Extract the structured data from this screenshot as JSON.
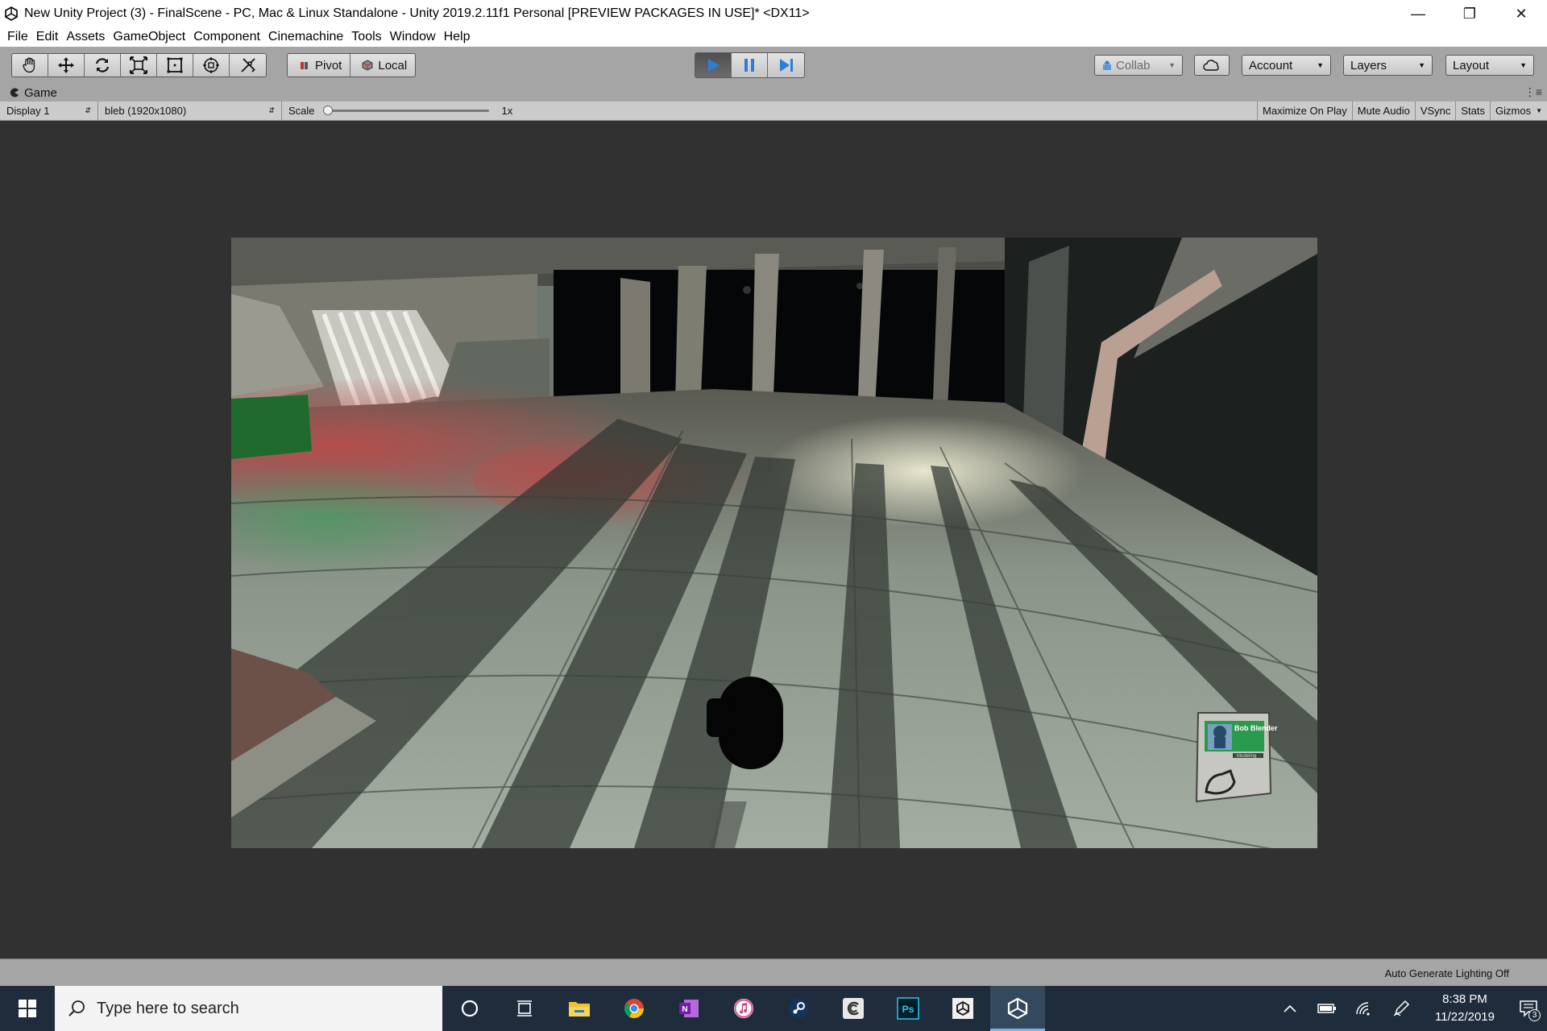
{
  "window": {
    "title": "New Unity Project (3) - FinalScene - PC, Mac & Linux Standalone - Unity 2019.2.11f1 Personal [PREVIEW PACKAGES IN USE]* <DX11>"
  },
  "menu": {
    "items": [
      "File",
      "Edit",
      "Assets",
      "GameObject",
      "Component",
      "Cinemachine",
      "Tools",
      "Window",
      "Help"
    ]
  },
  "toolbar": {
    "tools": [
      {
        "name": "hand-tool",
        "icon": "hand-icon"
      },
      {
        "name": "move-tool",
        "icon": "move-icon"
      },
      {
        "name": "rotate-tool",
        "icon": "rotate-icon"
      },
      {
        "name": "scale-tool",
        "icon": "scale-icon"
      },
      {
        "name": "rect-tool",
        "icon": "rect-icon"
      },
      {
        "name": "transform-tool",
        "icon": "transform-icon"
      },
      {
        "name": "custom-tool",
        "icon": "tools-icon"
      }
    ],
    "pivot_label": "Pivot",
    "local_label": "Local",
    "collab_label": "Collab",
    "account_label": "Account",
    "layers_label": "Layers",
    "layout_label": "Layout",
    "play_state": "playing",
    "accent_color": "#2a7fd4"
  },
  "game_tab": {
    "label": "Game"
  },
  "game_bar": {
    "display": "Display 1",
    "resolution": "bleb (1920x1080)",
    "scale_label": "Scale",
    "scale_value": "1x",
    "scale_level": 0,
    "toggles": [
      "Maximize On Play",
      "Mute Audio",
      "VSync",
      "Stats"
    ],
    "gizmos_label": "Gizmos"
  },
  "hud": {
    "badge_name": "Bob Blender",
    "badge_role": "Modeling"
  },
  "status": {
    "text": "Auto Generate Lighting Off"
  },
  "taskbar": {
    "search_placeholder": "Type here to search",
    "apps": [
      "cortana-icon",
      "task-view-icon",
      "file-explorer-icon",
      "chrome-icon",
      "onenote-icon",
      "itunes-icon",
      "steam-icon",
      "cinema4d-icon",
      "photoshop-icon",
      "unity-hub-icon",
      "unity-icon"
    ],
    "time": "8:38 PM",
    "date": "11/22/2019",
    "notification_count": "3"
  }
}
